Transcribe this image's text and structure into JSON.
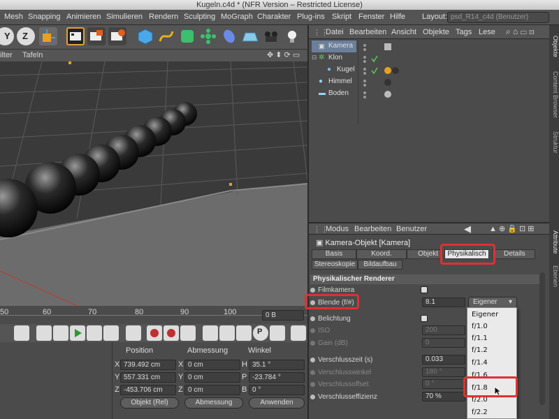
{
  "window": {
    "title": "Kugeln.c4d * (NFR Version – Restricted License)"
  },
  "menubar": {
    "items": [
      "Mesh",
      "Snapping",
      "Animieren",
      "Simulieren",
      "Rendern",
      "Sculpting",
      "MoGraph",
      "Charakter",
      "Plug-ins",
      "Skript",
      "Fenster",
      "Hilfe"
    ],
    "layout_label": "Layout:",
    "layout_value": "psd_R14_c4d (Benutzer)"
  },
  "viewport": {
    "menu": [
      "ilter",
      "Tafeln"
    ]
  },
  "timeline": {
    "ticks": [
      "50",
      "60",
      "70",
      "80",
      "90",
      "100"
    ],
    "frame": "0 B"
  },
  "coordinates": {
    "headers": [
      "Position",
      "Abmessung",
      "Winkel"
    ],
    "rows": [
      {
        "axis": "X",
        "pos": "739.492 cm",
        "size_axis": "X",
        "size": "0 cm",
        "rot_axis": "H",
        "rot": "35.1 °"
      },
      {
        "axis": "Y",
        "pos": "557.331 cm",
        "size_axis": "Y",
        "size": "0 cm",
        "rot_axis": "P",
        "rot": "-23.784 °"
      },
      {
        "axis": "Z",
        "pos": "-453.706 cm",
        "size_axis": "Z",
        "size": "0 cm",
        "rot_axis": "B",
        "rot": "0 °"
      }
    ],
    "mode_select": "Objekt (Rel)",
    "size_select": "Abmessung",
    "apply": "Anwenden"
  },
  "object_manager": {
    "menu": [
      "Datei",
      "Bearbeiten",
      "Ansicht",
      "Objekte",
      "Tags",
      "Lese"
    ],
    "objects": [
      {
        "name": "Kamera",
        "indent": 0,
        "selected": true
      },
      {
        "name": "Klon",
        "indent": 0,
        "selected": false
      },
      {
        "name": "Kugel",
        "indent": 1,
        "selected": false
      },
      {
        "name": "Himmel",
        "indent": 0,
        "selected": false
      },
      {
        "name": "Boden",
        "indent": 0,
        "selected": false
      }
    ]
  },
  "side_tabs": [
    "Objekte",
    "Content Browser",
    "Struktur",
    "Attribute",
    "Ebenen"
  ],
  "attributes": {
    "menu": [
      "Modus",
      "Bearbeiten",
      "Benutzer"
    ],
    "title": "Kamera-Objekt [Kamera]",
    "tabs_row1": [
      "Basis",
      "Koord.",
      "Objekt",
      "Physikalisch",
      "Details"
    ],
    "tabs_row2": [
      "Stereoskopie",
      "Bildaufbau"
    ],
    "active_tab": "Physikalisch",
    "section": "Physikalischer Renderer",
    "props": {
      "filmkamera": "Filmkamera",
      "blende": "Blende (f/#)",
      "blende_value": "8.1",
      "blende_select": "Eigener",
      "belichtung": "Belichtung",
      "iso": "ISO",
      "iso_value": "200",
      "gain": "Gain (dB)",
      "gain_value": "0",
      "verschlusszeit": "Verschlusszeit (s)",
      "verschlusszeit_value": "0.033",
      "verschlusswinkel": "Verschlusswinkel",
      "verschlusswinkel_value": "180 °",
      "verschlussoffset": "Verschlussoffset",
      "verschlussoffset_value": "0 °",
      "verschlusseffizienz": "Verschlusseffizienz",
      "verschlusseffizienz_value": "70 %"
    },
    "dropdown_options": [
      "Eigener",
      "f/1.0",
      "f/1.1",
      "f/1.2",
      "f/1.4",
      "f/1.6",
      "f/1.8",
      "f/2.0",
      "f/2.2"
    ],
    "highlighted_option": "f/1.8"
  },
  "colors": {
    "highlight_red": "#e03030",
    "axis_red": "#c0392b"
  }
}
